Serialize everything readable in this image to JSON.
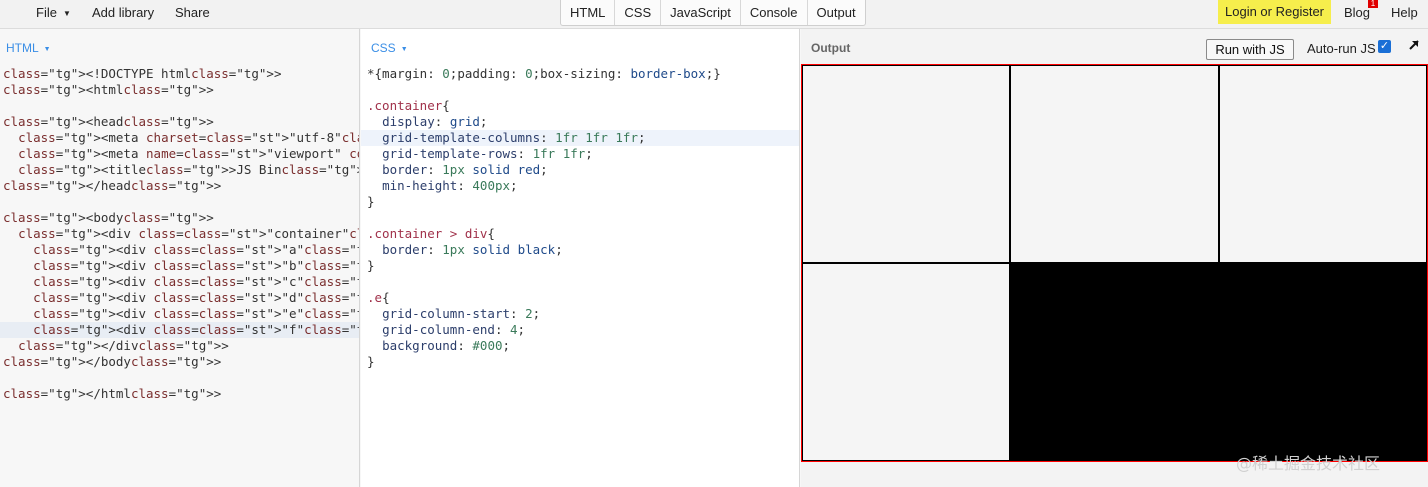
{
  "topbar": {
    "menus": [
      {
        "label": "File",
        "has_caret": true
      },
      {
        "label": "Add library"
      },
      {
        "label": "Share"
      }
    ],
    "tabs": [
      "HTML",
      "CSS",
      "JavaScript",
      "Console",
      "Output"
    ],
    "login_label": "Login or Register",
    "blog_label": "Blog",
    "blog_badge": "1",
    "help_label": "Help",
    "login_color": "#f6ee4c"
  },
  "html_panel": {
    "label": "HTML",
    "lines": [
      "<!DOCTYPE html>",
      "<html>",
      "",
      "<head>",
      "  <meta charset=\"utf-8\">",
      "  <meta name=\"viewport\" content=\"width=devi",
      "  <title>JS Bin</title>",
      "</head>",
      "",
      "<body>",
      "  <div class=\"container\">",
      "    <div class=\"a\"></div>",
      "    <div class=\"b\"></div>",
      "    <div class=\"c\"></div>",
      "    <div class=\"d\"></div>",
      "    <div class=\"e\"></div>",
      "    <div class=\"f\"></div>",
      "  </div>",
      "</body>",
      "",
      "</html>"
    ]
  },
  "css_panel": {
    "label": "CSS",
    "lines": [
      "*{margin: 0;padding: 0;box-sizing: border-box;}",
      "",
      ".container{",
      "  display: grid;",
      "  grid-template-columns: 1fr 1fr 1fr;",
      "  grid-template-rows: 1fr 1fr;",
      "  border: 1px solid red;",
      "  min-height: 400px;",
      "}",
      "",
      ".container > div{",
      "  border: 1px solid black;",
      "}",
      "",
      ".e{",
      "  grid-column-start: 2;",
      "  grid-column-end: 4;",
      "  background: #000;",
      "}"
    ]
  },
  "output_panel": {
    "title": "Output",
    "run_label": "Run with JS",
    "autorun_label": "Auto-run JS",
    "autorun_checked": true,
    "popout_icon": "arrow-up-right-icon",
    "cells": [
      "a",
      "b",
      "c",
      "d",
      "e",
      "f"
    ],
    "grid_border_color": "#ff0000",
    "cell_border_color": "#000000",
    "e_background": "#000000"
  },
  "watermark": "@稀土掘金技术社区"
}
